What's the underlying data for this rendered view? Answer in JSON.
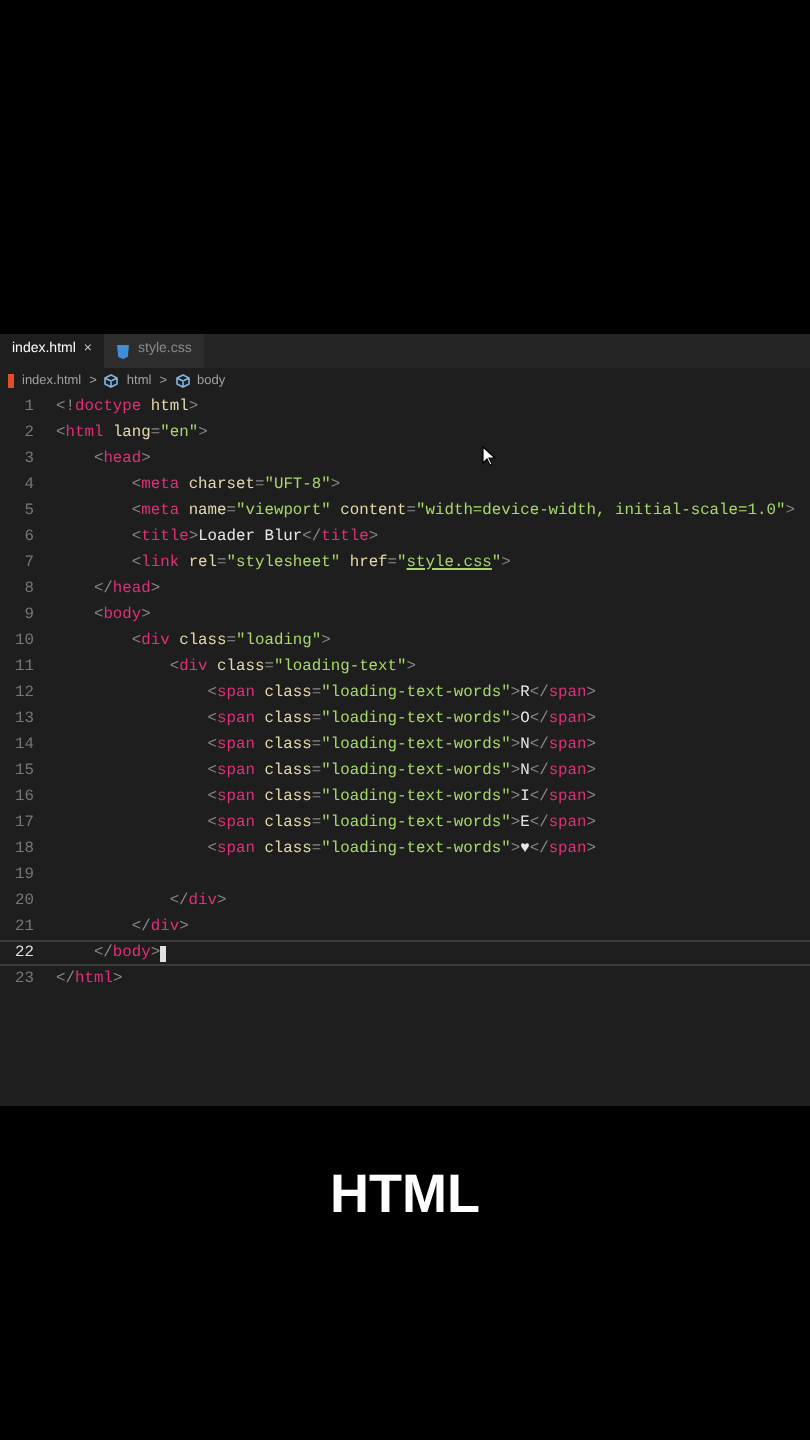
{
  "tabs": [
    {
      "label": "index.html",
      "selected": true,
      "close": "×",
      "kind": "html"
    },
    {
      "label": "style.css",
      "selected": false,
      "kind": "css"
    }
  ],
  "breadcrumb": [
    {
      "label": "index.html",
      "kind": "file"
    },
    {
      "label": "html",
      "kind": "element"
    },
    {
      "label": "body",
      "kind": "element"
    }
  ],
  "breadcrumb_separator": ">",
  "lines": [
    {
      "number": "1",
      "selected": false,
      "tokens": [
        {
          "kind": "punct",
          "text": "<!"
        },
        {
          "kind": "tag",
          "text": "doctype"
        },
        {
          "kind": "attr",
          "text": " html"
        },
        {
          "kind": "punct",
          "text": ">"
        }
      ]
    },
    {
      "number": "2",
      "selected": false,
      "tokens": [
        {
          "kind": "punct",
          "text": "<"
        },
        {
          "kind": "tag",
          "text": "html"
        },
        {
          "kind": "attr",
          "text": " lang"
        },
        {
          "kind": "punct",
          "text": "="
        },
        {
          "kind": "string",
          "text": "\"en\""
        },
        {
          "kind": "punct",
          "text": ">"
        }
      ]
    },
    {
      "number": "3",
      "selected": false,
      "tokens": [
        {
          "kind": "punct",
          "text": "    <"
        },
        {
          "kind": "tag",
          "text": "head"
        },
        {
          "kind": "punct",
          "text": ">"
        }
      ]
    },
    {
      "number": "4",
      "selected": false,
      "tokens": [
        {
          "kind": "punct",
          "text": "        <"
        },
        {
          "kind": "tag",
          "text": "meta"
        },
        {
          "kind": "attr",
          "text": " charset"
        },
        {
          "kind": "punct",
          "text": "="
        },
        {
          "kind": "string",
          "text": "\"UFT-8\""
        },
        {
          "kind": "punct",
          "text": ">"
        }
      ]
    },
    {
      "number": "5",
      "selected": false,
      "tokens": [
        {
          "kind": "punct",
          "text": "        <"
        },
        {
          "kind": "tag",
          "text": "meta"
        },
        {
          "kind": "attr",
          "text": " name"
        },
        {
          "kind": "punct",
          "text": "="
        },
        {
          "kind": "string",
          "text": "\"viewport\""
        },
        {
          "kind": "attr",
          "text": " content"
        },
        {
          "kind": "punct",
          "text": "="
        },
        {
          "kind": "string",
          "text": "\"width=device-width, initial-scale=1.0\""
        },
        {
          "kind": "punct",
          "text": ">"
        }
      ]
    },
    {
      "number": "6",
      "selected": false,
      "tokens": [
        {
          "kind": "punct",
          "text": "        <"
        },
        {
          "kind": "tag",
          "text": "title"
        },
        {
          "kind": "punct",
          "text": ">"
        },
        {
          "kind": "text",
          "text": "Loader Blur"
        },
        {
          "kind": "punct",
          "text": "</"
        },
        {
          "kind": "tag",
          "text": "title"
        },
        {
          "kind": "punct",
          "text": ">"
        }
      ]
    },
    {
      "number": "7",
      "selected": false,
      "tokens": [
        {
          "kind": "punct",
          "text": "        <"
        },
        {
          "kind": "tag",
          "text": "link"
        },
        {
          "kind": "attr",
          "text": " rel"
        },
        {
          "kind": "punct",
          "text": "="
        },
        {
          "kind": "string",
          "text": "\"stylesheet\""
        },
        {
          "kind": "attr",
          "text": " href"
        },
        {
          "kind": "punct",
          "text": "="
        },
        {
          "kind": "string",
          "text": "\""
        },
        {
          "kind": "link",
          "text": "style.css"
        },
        {
          "kind": "string",
          "text": "\""
        },
        {
          "kind": "punct",
          "text": ">"
        }
      ]
    },
    {
      "number": "8",
      "selected": false,
      "tokens": [
        {
          "kind": "punct",
          "text": "    </"
        },
        {
          "kind": "tag",
          "text": "head"
        },
        {
          "kind": "punct",
          "text": ">"
        }
      ]
    },
    {
      "number": "9",
      "selected": false,
      "tokens": [
        {
          "kind": "punct",
          "text": "    <"
        },
        {
          "kind": "tag",
          "text": "body"
        },
        {
          "kind": "punct",
          "text": ">"
        }
      ]
    },
    {
      "number": "10",
      "selected": false,
      "tokens": [
        {
          "kind": "punct",
          "text": "        <"
        },
        {
          "kind": "tag",
          "text": "div"
        },
        {
          "kind": "attr",
          "text": " class"
        },
        {
          "kind": "punct",
          "text": "="
        },
        {
          "kind": "string",
          "text": "\"loading\""
        },
        {
          "kind": "punct",
          "text": ">"
        }
      ]
    },
    {
      "number": "11",
      "selected": false,
      "tokens": [
        {
          "kind": "punct",
          "text": "            <"
        },
        {
          "kind": "tag",
          "text": "div"
        },
        {
          "kind": "attr",
          "text": " class"
        },
        {
          "kind": "punct",
          "text": "="
        },
        {
          "kind": "string",
          "text": "\"loading-text\""
        },
        {
          "kind": "punct",
          "text": ">"
        }
      ]
    },
    {
      "number": "12",
      "selected": false,
      "tokens": [
        {
          "kind": "punct",
          "text": "                <"
        },
        {
          "kind": "tag",
          "text": "span"
        },
        {
          "kind": "attr",
          "text": " class"
        },
        {
          "kind": "punct",
          "text": "="
        },
        {
          "kind": "string",
          "text": "\"loading-text-words\""
        },
        {
          "kind": "punct",
          "text": ">"
        },
        {
          "kind": "text",
          "text": "R"
        },
        {
          "kind": "punct",
          "text": "</"
        },
        {
          "kind": "tag",
          "text": "span"
        },
        {
          "kind": "punct",
          "text": ">"
        }
      ]
    },
    {
      "number": "13",
      "selected": false,
      "tokens": [
        {
          "kind": "punct",
          "text": "                <"
        },
        {
          "kind": "tag",
          "text": "span"
        },
        {
          "kind": "attr",
          "text": " class"
        },
        {
          "kind": "punct",
          "text": "="
        },
        {
          "kind": "string",
          "text": "\"loading-text-words\""
        },
        {
          "kind": "punct",
          "text": ">"
        },
        {
          "kind": "text",
          "text": "O"
        },
        {
          "kind": "punct",
          "text": "</"
        },
        {
          "kind": "tag",
          "text": "span"
        },
        {
          "kind": "punct",
          "text": ">"
        }
      ]
    },
    {
      "number": "14",
      "selected": false,
      "tokens": [
        {
          "kind": "punct",
          "text": "                <"
        },
        {
          "kind": "tag",
          "text": "span"
        },
        {
          "kind": "attr",
          "text": " class"
        },
        {
          "kind": "punct",
          "text": "="
        },
        {
          "kind": "string",
          "text": "\"loading-text-words\""
        },
        {
          "kind": "punct",
          "text": ">"
        },
        {
          "kind": "text",
          "text": "N"
        },
        {
          "kind": "punct",
          "text": "</"
        },
        {
          "kind": "tag",
          "text": "span"
        },
        {
          "kind": "punct",
          "text": ">"
        }
      ]
    },
    {
      "number": "15",
      "selected": false,
      "tokens": [
        {
          "kind": "punct",
          "text": "                <"
        },
        {
          "kind": "tag",
          "text": "span"
        },
        {
          "kind": "attr",
          "text": " class"
        },
        {
          "kind": "punct",
          "text": "="
        },
        {
          "kind": "string",
          "text": "\"loading-text-words\""
        },
        {
          "kind": "punct",
          "text": ">"
        },
        {
          "kind": "text",
          "text": "N"
        },
        {
          "kind": "punct",
          "text": "</"
        },
        {
          "kind": "tag",
          "text": "span"
        },
        {
          "kind": "punct",
          "text": ">"
        }
      ]
    },
    {
      "number": "16",
      "selected": false,
      "tokens": [
        {
          "kind": "punct",
          "text": "                <"
        },
        {
          "kind": "tag",
          "text": "span"
        },
        {
          "kind": "attr",
          "text": " class"
        },
        {
          "kind": "punct",
          "text": "="
        },
        {
          "kind": "string",
          "text": "\"loading-text-words\""
        },
        {
          "kind": "punct",
          "text": ">"
        },
        {
          "kind": "text",
          "text": "I"
        },
        {
          "kind": "punct",
          "text": "</"
        },
        {
          "kind": "tag",
          "text": "span"
        },
        {
          "kind": "punct",
          "text": ">"
        }
      ]
    },
    {
      "number": "17",
      "selected": false,
      "tokens": [
        {
          "kind": "punct",
          "text": "                <"
        },
        {
          "kind": "tag",
          "text": "span"
        },
        {
          "kind": "attr",
          "text": " class"
        },
        {
          "kind": "punct",
          "text": "="
        },
        {
          "kind": "string",
          "text": "\"loading-text-words\""
        },
        {
          "kind": "punct",
          "text": ">"
        },
        {
          "kind": "text",
          "text": "E"
        },
        {
          "kind": "punct",
          "text": "</"
        },
        {
          "kind": "tag",
          "text": "span"
        },
        {
          "kind": "punct",
          "text": ">"
        }
      ]
    },
    {
      "number": "18",
      "selected": false,
      "tokens": [
        {
          "kind": "punct",
          "text": "                <"
        },
        {
          "kind": "tag",
          "text": "span"
        },
        {
          "kind": "attr",
          "text": " class"
        },
        {
          "kind": "punct",
          "text": "="
        },
        {
          "kind": "string",
          "text": "\"loading-text-words\""
        },
        {
          "kind": "punct",
          "text": ">"
        },
        {
          "kind": "text",
          "text": "♥"
        },
        {
          "kind": "punct",
          "text": "</"
        },
        {
          "kind": "tag",
          "text": "span"
        },
        {
          "kind": "punct",
          "text": ">"
        }
      ]
    },
    {
      "number": "19",
      "selected": false
    },
    {
      "number": "20",
      "selected": false,
      "tokens": [
        {
          "kind": "punct",
          "text": "            </"
        },
        {
          "kind": "tag",
          "text": "div"
        },
        {
          "kind": "punct",
          "text": ">"
        }
      ]
    },
    {
      "number": "21",
      "selected": false,
      "tokens": [
        {
          "kind": "punct",
          "text": "        </"
        },
        {
          "kind": "tag",
          "text": "div"
        },
        {
          "kind": "punct",
          "text": ">"
        }
      ]
    },
    {
      "number": "22",
      "selected": true,
      "tokens": [
        {
          "kind": "punct",
          "text": "    </"
        },
        {
          "kind": "tag",
          "text": "body"
        },
        {
          "kind": "punct",
          "text": ">"
        }
      ]
    },
    {
      "number": "23",
      "selected": false,
      "tokens": [
        {
          "kind": "punct",
          "text": "</"
        },
        {
          "kind": "tag",
          "text": "html"
        },
        {
          "kind": "punct",
          "text": ">"
        }
      ]
    }
  ],
  "caption": "HTML"
}
